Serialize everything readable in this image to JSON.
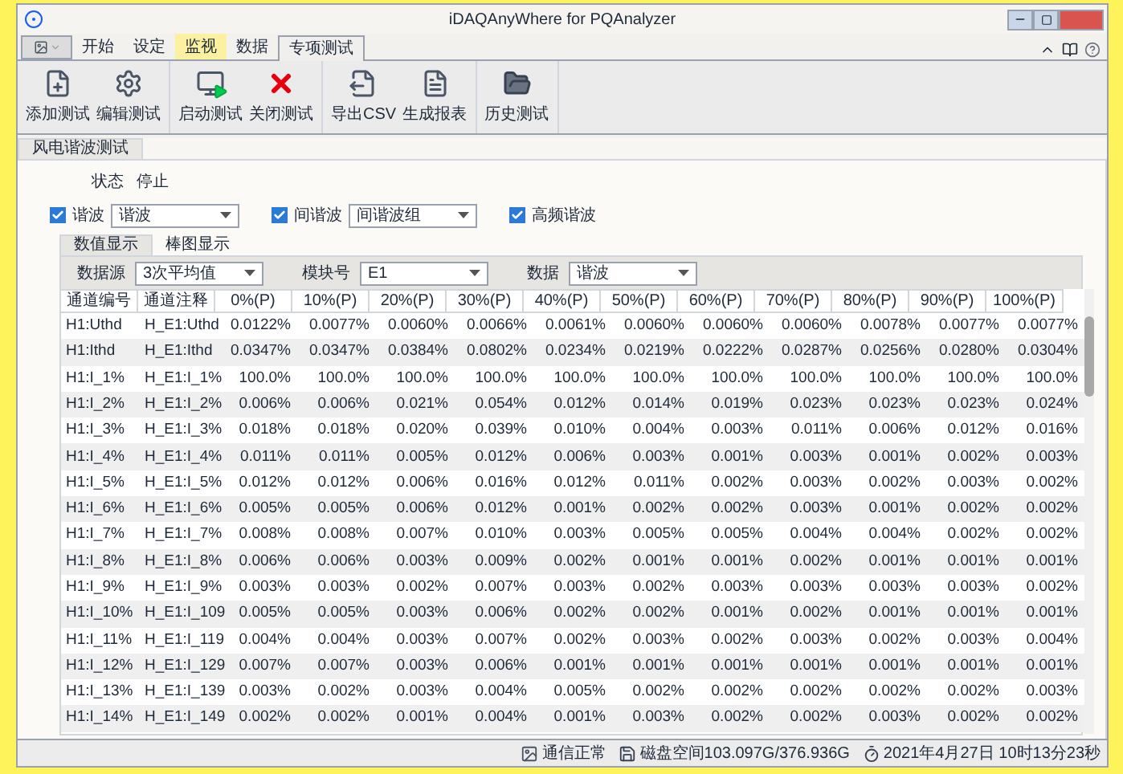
{
  "window": {
    "title": "iDAQAnyWhere for PQAnalyzer"
  },
  "ribbon_tabs": [
    {
      "label": "开始",
      "selected": false,
      "highlighted": false
    },
    {
      "label": "设定",
      "selected": false,
      "highlighted": false
    },
    {
      "label": "监视",
      "selected": false,
      "highlighted": true
    },
    {
      "label": "数据",
      "selected": false,
      "highlighted": false
    },
    {
      "label": "专项测试",
      "selected": true,
      "highlighted": false
    }
  ],
  "toolbar_groups": [
    [
      {
        "label": "添加测试",
        "kind": "add"
      },
      {
        "label": "编辑测试",
        "kind": "edit"
      }
    ],
    [
      {
        "label": "启动测试",
        "kind": "start"
      },
      {
        "label": "关闭测试",
        "kind": "close"
      }
    ],
    [
      {
        "label": "导出CSV",
        "kind": "csv"
      },
      {
        "label": "生成报表",
        "kind": "report"
      }
    ],
    [
      {
        "label": "历史测试",
        "kind": "history"
      }
    ]
  ],
  "document_tab": "风电谐波测试",
  "status": {
    "label": "状态",
    "value": "停止"
  },
  "options": [
    {
      "label": "谐波",
      "checked": true,
      "dropdown": "谐波"
    },
    {
      "label": "间谐波",
      "checked": true,
      "dropdown": "间谐波组"
    },
    {
      "label": "高频谐波",
      "checked": true
    }
  ],
  "view_tabs": [
    {
      "label": "数值显示",
      "selected": true
    },
    {
      "label": "棒图显示",
      "selected": false
    }
  ],
  "filters": [
    {
      "label": "数据源",
      "value": "3次平均值"
    },
    {
      "label": "模块号",
      "value": "E1"
    },
    {
      "label": "数据",
      "value": "谐波"
    }
  ],
  "table": {
    "columns": [
      "通道编号",
      "通道注释",
      "0%(P)",
      "10%(P)",
      "20%(P)",
      "30%(P)",
      "40%(P)",
      "50%(P)",
      "60%(P)",
      "70%(P)",
      "80%(P)",
      "90%(P)",
      "100%(P)"
    ],
    "rows": [
      [
        "H1:Uthd",
        "H_E1:Uthd",
        "0.0122%",
        "0.0077%",
        "0.0060%",
        "0.0066%",
        "0.0061%",
        "0.0060%",
        "0.0060%",
        "0.0060%",
        "0.0078%",
        "0.0077%",
        "0.0077%"
      ],
      [
        "H1:Ithd",
        "H_E1:Ithd",
        "0.0347%",
        "0.0347%",
        "0.0384%",
        "0.0802%",
        "0.0234%",
        "0.0219%",
        "0.0222%",
        "0.0287%",
        "0.0256%",
        "0.0280%",
        "0.0304%"
      ],
      [
        "H1:I_1%",
        "H_E1:I_1%",
        "100.0%",
        "100.0%",
        "100.0%",
        "100.0%",
        "100.0%",
        "100.0%",
        "100.0%",
        "100.0%",
        "100.0%",
        "100.0%",
        "100.0%"
      ],
      [
        "H1:I_2%",
        "H_E1:I_2%",
        "0.006%",
        "0.006%",
        "0.021%",
        "0.054%",
        "0.012%",
        "0.014%",
        "0.019%",
        "0.023%",
        "0.023%",
        "0.023%",
        "0.024%"
      ],
      [
        "H1:I_3%",
        "H_E1:I_3%",
        "0.018%",
        "0.018%",
        "0.020%",
        "0.039%",
        "0.010%",
        "0.004%",
        "0.003%",
        "0.011%",
        "0.006%",
        "0.012%",
        "0.016%"
      ],
      [
        "H1:I_4%",
        "H_E1:I_4%",
        "0.011%",
        "0.011%",
        "0.005%",
        "0.012%",
        "0.006%",
        "0.003%",
        "0.001%",
        "0.003%",
        "0.001%",
        "0.002%",
        "0.003%"
      ],
      [
        "H1:I_5%",
        "H_E1:I_5%",
        "0.012%",
        "0.012%",
        "0.006%",
        "0.016%",
        "0.012%",
        "0.011%",
        "0.002%",
        "0.003%",
        "0.002%",
        "0.003%",
        "0.002%"
      ],
      [
        "H1:I_6%",
        "H_E1:I_6%",
        "0.005%",
        "0.005%",
        "0.006%",
        "0.012%",
        "0.001%",
        "0.002%",
        "0.002%",
        "0.003%",
        "0.001%",
        "0.002%",
        "0.002%"
      ],
      [
        "H1:I_7%",
        "H_E1:I_7%",
        "0.008%",
        "0.008%",
        "0.007%",
        "0.010%",
        "0.003%",
        "0.005%",
        "0.005%",
        "0.004%",
        "0.004%",
        "0.002%",
        "0.002%"
      ],
      [
        "H1:I_8%",
        "H_E1:I_8%",
        "0.006%",
        "0.006%",
        "0.003%",
        "0.009%",
        "0.002%",
        "0.001%",
        "0.001%",
        "0.002%",
        "0.001%",
        "0.001%",
        "0.001%"
      ],
      [
        "H1:I_9%",
        "H_E1:I_9%",
        "0.003%",
        "0.003%",
        "0.002%",
        "0.007%",
        "0.003%",
        "0.002%",
        "0.003%",
        "0.003%",
        "0.003%",
        "0.003%",
        "0.002%"
      ],
      [
        "H1:I_10%",
        "H_E1:I_109",
        "0.005%",
        "0.005%",
        "0.003%",
        "0.006%",
        "0.002%",
        "0.002%",
        "0.001%",
        "0.002%",
        "0.001%",
        "0.001%",
        "0.001%"
      ],
      [
        "H1:I_11%",
        "H_E1:I_119",
        "0.004%",
        "0.004%",
        "0.003%",
        "0.007%",
        "0.002%",
        "0.003%",
        "0.002%",
        "0.003%",
        "0.002%",
        "0.003%",
        "0.004%"
      ],
      [
        "H1:I_12%",
        "H_E1:I_129",
        "0.007%",
        "0.007%",
        "0.003%",
        "0.006%",
        "0.001%",
        "0.001%",
        "0.001%",
        "0.001%",
        "0.001%",
        "0.001%",
        "0.001%"
      ],
      [
        "H1:I_13%",
        "H_E1:I_139",
        "0.003%",
        "0.002%",
        "0.003%",
        "0.004%",
        "0.005%",
        "0.002%",
        "0.002%",
        "0.002%",
        "0.002%",
        "0.002%",
        "0.003%"
      ],
      [
        "H1:I_14%",
        "H_E1:I_149",
        "0.002%",
        "0.002%",
        "0.001%",
        "0.004%",
        "0.001%",
        "0.003%",
        "0.002%",
        "0.002%",
        "0.003%",
        "0.002%",
        "0.002%"
      ]
    ]
  },
  "status_bar": [
    {
      "kind": "comm",
      "text": "通信正常"
    },
    {
      "kind": "disk",
      "text": "磁盘空间103.097G/376.936G"
    },
    {
      "kind": "clock",
      "text": "2021年4月27日 10时13分23秒"
    }
  ]
}
